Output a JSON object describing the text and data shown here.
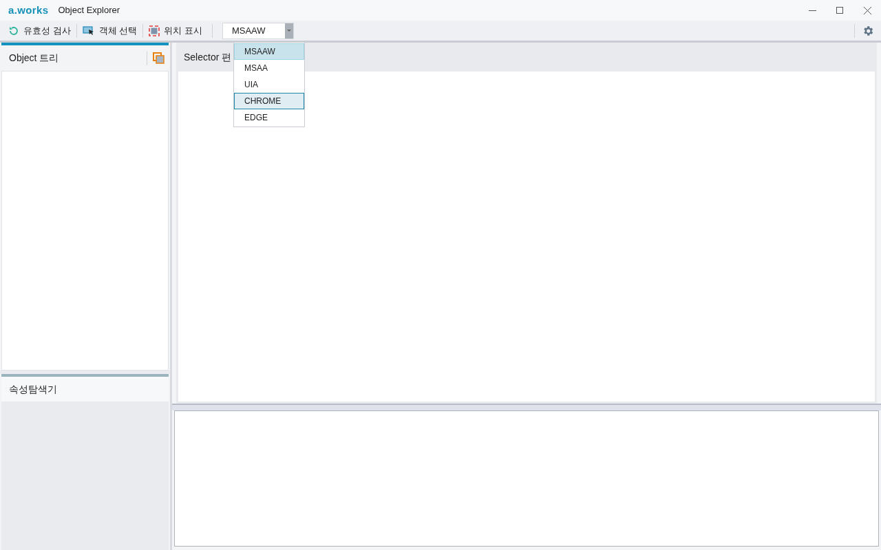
{
  "window": {
    "logo": "a.works",
    "title": "Object Explorer"
  },
  "toolbar": {
    "buttons": [
      "유효성 검사",
      "객체 선택",
      "위치 표시"
    ],
    "combo_value": "MSAAW"
  },
  "dropdown": [
    {
      "label": "MSAAW",
      "selected": true,
      "hovered": false
    },
    {
      "label": "MSAA",
      "selected": false,
      "hovered": false
    },
    {
      "label": "UIA",
      "selected": false,
      "hovered": false
    },
    {
      "label": "CHROME",
      "selected": false,
      "hovered": true
    },
    {
      "label": "EDGE",
      "selected": false,
      "hovered": false
    }
  ],
  "object_tree": {
    "title": "Object 트리"
  },
  "property_explorer": {
    "title": "속성탐색기"
  },
  "selector_editor": {
    "title": "Selector 편"
  }
}
